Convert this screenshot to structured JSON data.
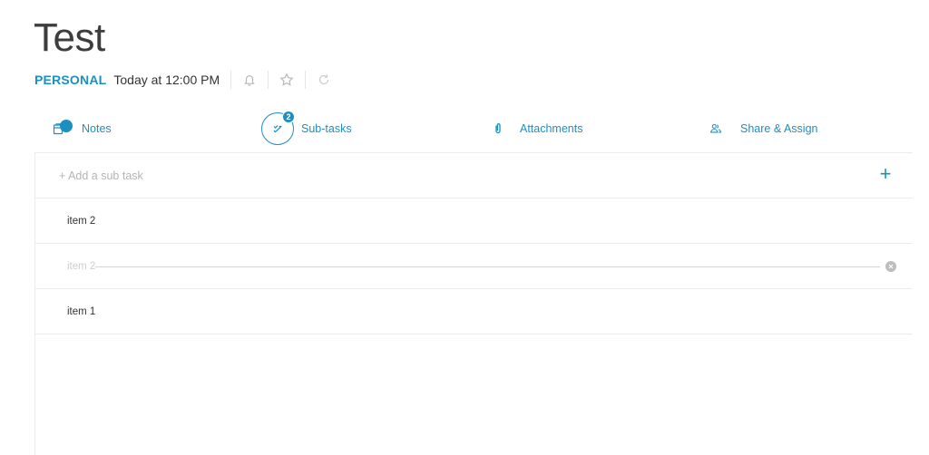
{
  "task": {
    "title": "Test",
    "category": "PERSONAL",
    "due": "Today at 12:00 PM"
  },
  "actions": {
    "icons": [
      "bell-icon",
      "star-icon",
      "repeat-icon"
    ]
  },
  "tabs": [
    {
      "label": "Notes",
      "icon": "clipboard-icon"
    },
    {
      "label": "Sub-tasks",
      "icon": "checklist-icon",
      "badge": "2"
    },
    {
      "label": "Attachments",
      "icon": "paperclip-icon"
    },
    {
      "label": "Share & Assign",
      "icon": "share-people-icon"
    }
  ],
  "subtasks": {
    "add_placeholder": "+ Add a sub task",
    "items": [
      {
        "text": "item 2",
        "completed": false
      },
      {
        "text": "item 2",
        "completed": true
      },
      {
        "text": "item 1",
        "completed": false
      }
    ]
  },
  "colors": {
    "accent": "#1c8fc1",
    "border": "#ececec",
    "completed_text": "#cfcfcf"
  }
}
